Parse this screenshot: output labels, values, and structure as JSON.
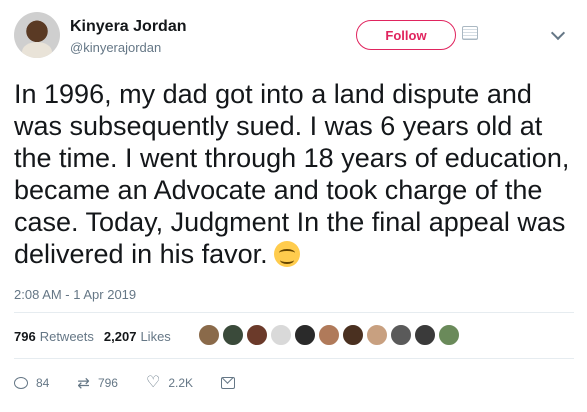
{
  "user": {
    "display_name": "Kinyera Jordan",
    "handle": "@kinyerajordan",
    "follow_label": "Follow"
  },
  "tweet": {
    "text": "In 1996, my dad got into a land dispute and was subsequently sued. I was 6 years old at the time. I went through 18 years of education, became an Advocate and took charge of the case. Today, Judgment In the final appeal was delivered in his favor.",
    "emoji": "smiling-face-with-smiling-eyes",
    "timestamp": "2:08 AM - 1 Apr 2019"
  },
  "stats": {
    "retweets_count": "796",
    "retweets_label": "Retweets",
    "likes_count": "2,207",
    "likes_label": "Likes"
  },
  "likers": [
    "#8a6a4a",
    "#3a4a3a",
    "#6b3a2a",
    "#d9d9d9",
    "#2a2a2a",
    "#b07a5a",
    "#4a3020",
    "#c8a080",
    "#5a5a5a",
    "#3a3a3a",
    "#6a8a5a"
  ],
  "actions": {
    "replies": "84",
    "retweets": "796",
    "likes": "2.2K"
  },
  "colors": {
    "follow_accent": "#e0245e",
    "muted_text": "#657786",
    "emoji_face": "#ffcc4d"
  }
}
